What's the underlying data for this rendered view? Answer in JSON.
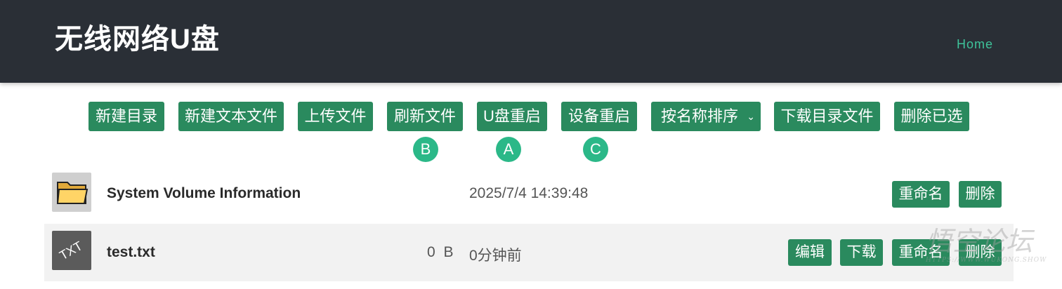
{
  "header": {
    "title": "无线网络U盘",
    "nav_home": "Home"
  },
  "toolbar": {
    "new_folder": "新建目录",
    "new_text_file": "新建文本文件",
    "upload_file": "上传文件",
    "refresh_files": "刷新文件",
    "usb_restart": "U盘重启",
    "device_restart": "设备重启",
    "sort_select": "按名称排序",
    "download_dir_file": "下载目录文件",
    "delete_selected": "删除已选"
  },
  "badges": {
    "b": "B",
    "a": "A",
    "c": "C"
  },
  "files": [
    {
      "name": "System Volume Information",
      "size": "",
      "time": "2025/7/4 14:39:48",
      "icon": "folder-icon",
      "actions": {
        "rename": "重命名",
        "delete": "删除"
      }
    },
    {
      "name": "test.txt",
      "size": "0 B",
      "time": "0分钟前",
      "icon": "txt-file-icon",
      "icon_text": "TXT",
      "actions": {
        "edit": "编辑",
        "download": "下载",
        "rename": "重命名",
        "delete": "删除"
      }
    }
  ],
  "colors": {
    "header_bg": "#2a2f36",
    "button_green": "#2a8a5e",
    "badge_green": "#2bb888",
    "nav_link": "#3ec39a"
  },
  "watermark": {
    "text": "悟空论坛",
    "sub": "HTTPS://WWW.WUKONG.SHOW"
  }
}
